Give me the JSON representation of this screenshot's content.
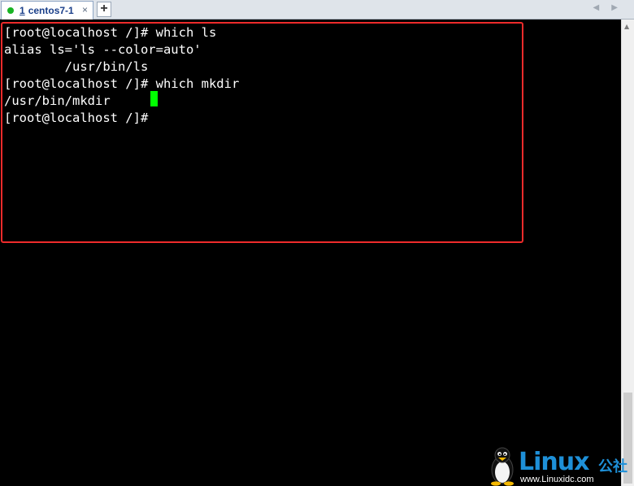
{
  "tab": {
    "number": "1",
    "title": "centos7-1",
    "close": "×",
    "new_tab": "+"
  },
  "nav_arrows": "◀ ▶",
  "terminal": {
    "lines": [
      "[root@localhost /]# which ls",
      "alias ls='ls --color=auto'",
      "        /usr/bin/ls",
      "[root@localhost /]# which mkdir",
      "/usr/bin/mkdir",
      "[root@localhost /]# "
    ],
    "cursor_color": "#00ff00",
    "highlight_color": "#ee2b2b"
  },
  "watermark": {
    "brand": "Linux",
    "brand_cn": "公社",
    "url": "www.Linuxidc.com"
  },
  "icons": [
    "status-dot-icon",
    "close-icon",
    "plus-icon",
    "tux-penguin-icon",
    "scroll-up-arrow-icon"
  ]
}
